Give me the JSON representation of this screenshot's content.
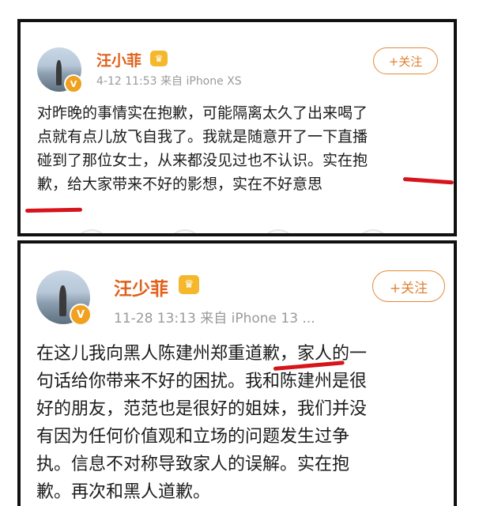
{
  "posts": [
    {
      "username": "汪小菲",
      "vip_icon": "vip-crown-icon",
      "vip_glyph": "♛",
      "verified_icon": "verified-v-icon",
      "verified_glyph": "V",
      "timestamp": "4-12 11:53",
      "source": "来自 iPhone XS",
      "follow_label": "+关注",
      "body_lines": [
        "对昨晚的事情实在抱歉，可能隔离太久了出来喝了",
        "点就有点儿放飞自我了。我就是随意开了一下直播",
        "碰到了那位女士，从来都没见过也不认识。实在抱",
        "歉，给大家带来不好的影想，实在不好意思"
      ]
    },
    {
      "username": "汪少菲",
      "vip_icon": "vip-crown-icon",
      "vip_glyph": "♛",
      "verified_icon": "verified-v-icon",
      "verified_glyph": "V",
      "timestamp": "11-28 13:13",
      "source": "来自 iPhone 13 ...",
      "follow_label": "+关注",
      "body_lines": [
        "在这儿我向黑人陈建州郑重道歉，家人的一",
        "句话给你带来不好的困扰。我和陈建州是很",
        "好的朋友，范范也是很好的姐妹，我们并没",
        "有因为任何价值观和立场的问题发生过争",
        "执。信息不对称导致家人的误解。实在抱",
        "歉。再次和黑人道歉。"
      ]
    }
  ],
  "colors": {
    "username": "#e0601a",
    "follow": "#e08132",
    "highlight_underline": "#d7131b",
    "border": "#111111"
  }
}
